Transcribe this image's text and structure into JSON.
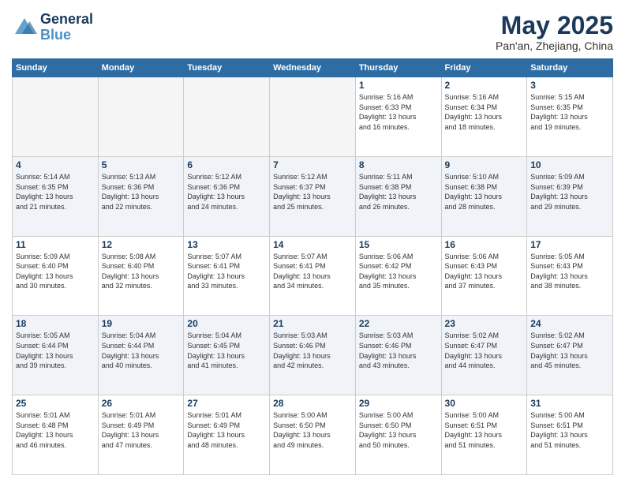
{
  "header": {
    "logo_line1": "General",
    "logo_line2": "Blue",
    "month": "May 2025",
    "location": "Pan'an, Zhejiang, China"
  },
  "weekdays": [
    "Sunday",
    "Monday",
    "Tuesday",
    "Wednesday",
    "Thursday",
    "Friday",
    "Saturday"
  ],
  "weeks": [
    [
      {
        "day": "",
        "info": "",
        "empty": true
      },
      {
        "day": "",
        "info": "",
        "empty": true
      },
      {
        "day": "",
        "info": "",
        "empty": true
      },
      {
        "day": "",
        "info": "",
        "empty": true
      },
      {
        "day": "1",
        "info": "Sunrise: 5:16 AM\nSunset: 6:33 PM\nDaylight: 13 hours\nand 16 minutes."
      },
      {
        "day": "2",
        "info": "Sunrise: 5:16 AM\nSunset: 6:34 PM\nDaylight: 13 hours\nand 18 minutes."
      },
      {
        "day": "3",
        "info": "Sunrise: 5:15 AM\nSunset: 6:35 PM\nDaylight: 13 hours\nand 19 minutes."
      }
    ],
    [
      {
        "day": "4",
        "info": "Sunrise: 5:14 AM\nSunset: 6:35 PM\nDaylight: 13 hours\nand 21 minutes."
      },
      {
        "day": "5",
        "info": "Sunrise: 5:13 AM\nSunset: 6:36 PM\nDaylight: 13 hours\nand 22 minutes."
      },
      {
        "day": "6",
        "info": "Sunrise: 5:12 AM\nSunset: 6:36 PM\nDaylight: 13 hours\nand 24 minutes."
      },
      {
        "day": "7",
        "info": "Sunrise: 5:12 AM\nSunset: 6:37 PM\nDaylight: 13 hours\nand 25 minutes."
      },
      {
        "day": "8",
        "info": "Sunrise: 5:11 AM\nSunset: 6:38 PM\nDaylight: 13 hours\nand 26 minutes."
      },
      {
        "day": "9",
        "info": "Sunrise: 5:10 AM\nSunset: 6:38 PM\nDaylight: 13 hours\nand 28 minutes."
      },
      {
        "day": "10",
        "info": "Sunrise: 5:09 AM\nSunset: 6:39 PM\nDaylight: 13 hours\nand 29 minutes."
      }
    ],
    [
      {
        "day": "11",
        "info": "Sunrise: 5:09 AM\nSunset: 6:40 PM\nDaylight: 13 hours\nand 30 minutes."
      },
      {
        "day": "12",
        "info": "Sunrise: 5:08 AM\nSunset: 6:40 PM\nDaylight: 13 hours\nand 32 minutes."
      },
      {
        "day": "13",
        "info": "Sunrise: 5:07 AM\nSunset: 6:41 PM\nDaylight: 13 hours\nand 33 minutes."
      },
      {
        "day": "14",
        "info": "Sunrise: 5:07 AM\nSunset: 6:41 PM\nDaylight: 13 hours\nand 34 minutes."
      },
      {
        "day": "15",
        "info": "Sunrise: 5:06 AM\nSunset: 6:42 PM\nDaylight: 13 hours\nand 35 minutes."
      },
      {
        "day": "16",
        "info": "Sunrise: 5:06 AM\nSunset: 6:43 PM\nDaylight: 13 hours\nand 37 minutes."
      },
      {
        "day": "17",
        "info": "Sunrise: 5:05 AM\nSunset: 6:43 PM\nDaylight: 13 hours\nand 38 minutes."
      }
    ],
    [
      {
        "day": "18",
        "info": "Sunrise: 5:05 AM\nSunset: 6:44 PM\nDaylight: 13 hours\nand 39 minutes."
      },
      {
        "day": "19",
        "info": "Sunrise: 5:04 AM\nSunset: 6:44 PM\nDaylight: 13 hours\nand 40 minutes."
      },
      {
        "day": "20",
        "info": "Sunrise: 5:04 AM\nSunset: 6:45 PM\nDaylight: 13 hours\nand 41 minutes."
      },
      {
        "day": "21",
        "info": "Sunrise: 5:03 AM\nSunset: 6:46 PM\nDaylight: 13 hours\nand 42 minutes."
      },
      {
        "day": "22",
        "info": "Sunrise: 5:03 AM\nSunset: 6:46 PM\nDaylight: 13 hours\nand 43 minutes."
      },
      {
        "day": "23",
        "info": "Sunrise: 5:02 AM\nSunset: 6:47 PM\nDaylight: 13 hours\nand 44 minutes."
      },
      {
        "day": "24",
        "info": "Sunrise: 5:02 AM\nSunset: 6:47 PM\nDaylight: 13 hours\nand 45 minutes."
      }
    ],
    [
      {
        "day": "25",
        "info": "Sunrise: 5:01 AM\nSunset: 6:48 PM\nDaylight: 13 hours\nand 46 minutes."
      },
      {
        "day": "26",
        "info": "Sunrise: 5:01 AM\nSunset: 6:49 PM\nDaylight: 13 hours\nand 47 minutes."
      },
      {
        "day": "27",
        "info": "Sunrise: 5:01 AM\nSunset: 6:49 PM\nDaylight: 13 hours\nand 48 minutes."
      },
      {
        "day": "28",
        "info": "Sunrise: 5:00 AM\nSunset: 6:50 PM\nDaylight: 13 hours\nand 49 minutes."
      },
      {
        "day": "29",
        "info": "Sunrise: 5:00 AM\nSunset: 6:50 PM\nDaylight: 13 hours\nand 50 minutes."
      },
      {
        "day": "30",
        "info": "Sunrise: 5:00 AM\nSunset: 6:51 PM\nDaylight: 13 hours\nand 51 minutes."
      },
      {
        "day": "31",
        "info": "Sunrise: 5:00 AM\nSunset: 6:51 PM\nDaylight: 13 hours\nand 51 minutes."
      }
    ]
  ]
}
